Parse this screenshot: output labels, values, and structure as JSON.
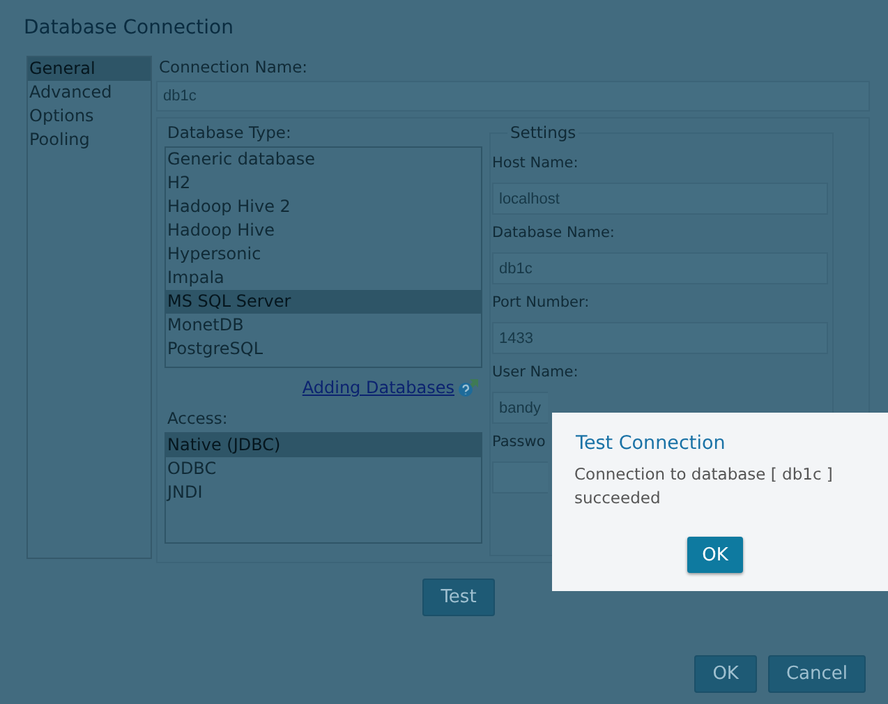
{
  "window": {
    "title": "Database Connection"
  },
  "nav": [
    {
      "label": "General",
      "selected": true
    },
    {
      "label": "Advanced",
      "selected": false
    },
    {
      "label": "Options",
      "selected": false
    },
    {
      "label": "Pooling",
      "selected": false
    }
  ],
  "connection_name": {
    "label": "Connection Name:",
    "value": "db1c"
  },
  "database_type": {
    "label": "Database Type:",
    "items": [
      {
        "label": "Generic database",
        "selected": false
      },
      {
        "label": "H2",
        "selected": false
      },
      {
        "label": "Hadoop Hive 2",
        "selected": false
      },
      {
        "label": "Hadoop Hive",
        "selected": false
      },
      {
        "label": "Hypersonic",
        "selected": false
      },
      {
        "label": "Impala",
        "selected": false
      },
      {
        "label": "MS SQL Server",
        "selected": true
      },
      {
        "label": "MonetDB",
        "selected": false
      },
      {
        "label": "PostgreSQL",
        "selected": false
      }
    ]
  },
  "help_link": "Adding Databases",
  "access": {
    "label": "Access:",
    "items": [
      {
        "label": "Native (JDBC)",
        "selected": true
      },
      {
        "label": "ODBC",
        "selected": false
      },
      {
        "label": "JNDI",
        "selected": false
      }
    ]
  },
  "settings": {
    "legend": "Settings",
    "fields": [
      {
        "label": "Host Name:",
        "value": "localhost"
      },
      {
        "label": "Database Name:",
        "value": "db1c"
      },
      {
        "label": "Port Number:",
        "value": "1433"
      },
      {
        "label": "User Name:",
        "value": "bandy"
      },
      {
        "label": "Passwo"
      }
    ]
  },
  "test_button": "Test",
  "buttons": [
    "OK",
    "Cancel"
  ],
  "modal": {
    "title": "Test Connection",
    "message": "Connection to database [ db1c ] succeeded",
    "button": "OK"
  }
}
